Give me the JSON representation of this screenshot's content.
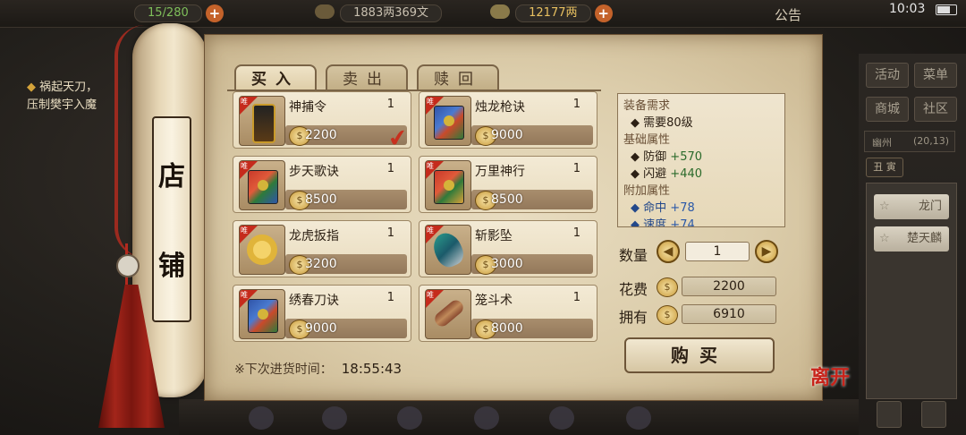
{
  "topbar": {
    "bag": "15/280",
    "copper": "1883两369文",
    "silver": "12177两",
    "notice": "公告",
    "time": "10:03"
  },
  "quest": {
    "line1": "祸起天刀，",
    "line2": "压制樊宇入魔"
  },
  "side": {
    "activity": "活动",
    "menu": "菜单",
    "mall": "商城",
    "community": "社区",
    "location": "幽州",
    "coords": "(20,13)",
    "seal_tab": "丑 寅",
    "members": [
      "龙门",
      "楚天麟"
    ]
  },
  "shop": {
    "title_chars": [
      "店",
      "铺"
    ],
    "tabs": [
      "买入",
      "卖出",
      "赎回"
    ],
    "badge": "唯",
    "items": [
      {
        "name": "神捕令",
        "qty": "1",
        "price": "2200",
        "icon": "token-icon"
      },
      {
        "name": "烛龙枪诀",
        "qty": "1",
        "price": "9000",
        "icon": "skill-book-icon"
      },
      {
        "name": "步天歌诀",
        "qty": "1",
        "price": "8500",
        "icon": "skill-book-icon"
      },
      {
        "name": "万里神行",
        "qty": "1",
        "price": "8500",
        "icon": "skill-book-icon"
      },
      {
        "name": "龙虎扳指",
        "qty": "1",
        "price": "3200",
        "icon": "ring-icon"
      },
      {
        "name": "斩影坠",
        "qty": "1",
        "price": "3000",
        "icon": "pendant-icon"
      },
      {
        "name": "绣春刀诀",
        "qty": "1",
        "price": "9000",
        "icon": "skill-book-icon"
      },
      {
        "name": "笼斗术",
        "qty": "1",
        "price": "8000",
        "icon": "scroll-icon"
      }
    ],
    "selected_index": 0,
    "restock_label": "※下次进货时间：",
    "restock_time": "18:55:43"
  },
  "detail": {
    "req_title": "装备需求",
    "req_level": "需要80级",
    "base_title": "基础属性",
    "base": [
      {
        "name": "防御",
        "value": "+570"
      },
      {
        "name": "闪避",
        "value": "+440"
      }
    ],
    "extra_title": "附加属性",
    "extra": [
      {
        "name": "命中",
        "value": "+78"
      },
      {
        "name": "速度",
        "value": "+74"
      }
    ]
  },
  "purchase": {
    "qty_label": "数量",
    "qty_value": "1",
    "cost_label": "花费",
    "cost_value": "2200",
    "own_label": "拥有",
    "own_value": "6910",
    "buy_label": "购买"
  },
  "leave_label": "离开",
  "colors": {
    "accent_red": "#c52b1c",
    "gold": "#c99a3a",
    "parchment": "#e8dcc0"
  }
}
